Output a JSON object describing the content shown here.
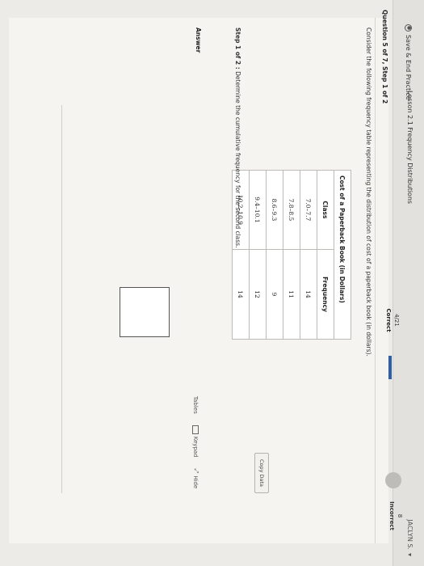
{
  "topbar": {
    "save_label": "Save & End Practice",
    "lesson_label": "Lesson 2.1 Frequency Distributions",
    "user_name": "JACLYN S."
  },
  "question": {
    "number_label": "Question 5 of 7,  Step 1 of 2",
    "progress_score": "4/21",
    "correct_label": "Correct",
    "progress_fraction": 0.19,
    "incorrect_count": "8",
    "incorrect_label": "Incorrect",
    "intro": "Consider the following frequency table representing the distribution of cost of a paperback book (in dollars)."
  },
  "table": {
    "caption": "Cost of a Paperback Book (in Dollars)",
    "headers": [
      "Class",
      "Frequency"
    ],
    "rows": [
      [
        "7.0–7.7",
        "14"
      ],
      [
        "7.8–8.5",
        "11"
      ],
      [
        "8.6–9.3",
        "9"
      ],
      [
        "9.4–10.1",
        "12"
      ],
      [
        "10.2–10.9",
        "14"
      ]
    ],
    "copy_label": "Copy Data"
  },
  "step": {
    "bold": "Step 1 of 2 :",
    "text": " Determine the cumulative frequency for the second class."
  },
  "answer": {
    "label": "Answer",
    "tools": [
      "Tables",
      "Keypad",
      "Hide"
    ]
  },
  "colors": {
    "accent": "#2d5ea8"
  }
}
